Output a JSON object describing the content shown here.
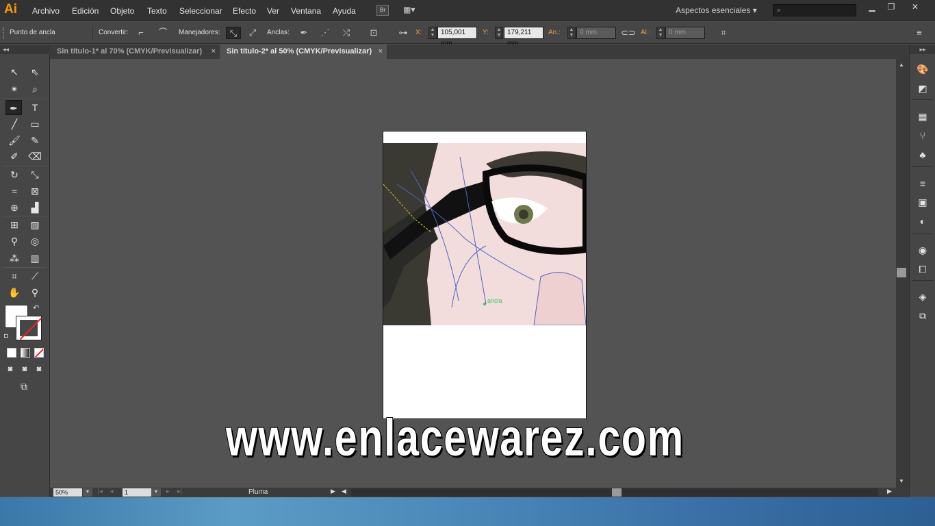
{
  "app": {
    "logo": "Ai",
    "menus": [
      "Archivo",
      "Edición",
      "Objeto",
      "Texto",
      "Seleccionar",
      "Efecto",
      "Ver",
      "Ventana",
      "Ayuda"
    ],
    "bridge_label": "Br",
    "workspace": "Aspectos esenciales",
    "search_placeholder": "⌕"
  },
  "control_bar": {
    "selection_label": "Punto de ancla",
    "convert_label": "Convertir:",
    "handles_label": "Manejadores:",
    "anchors_label": "Anclas:",
    "x_label": "X:",
    "x_value": "105,001 mm",
    "y_label": "Y:",
    "y_value": "179,211 mm",
    "w_label": "An.:",
    "w_value": "0 mm",
    "h_label": "Al.:",
    "h_value": "0 mm"
  },
  "tabs": [
    {
      "label": "Sin título-1* al 70% (CMYK/Previsualizar)",
      "close": "×"
    },
    {
      "label": "Sin título-2* al 50% (CMYK/Previsualizar)",
      "close": "×"
    }
  ],
  "canvas": {
    "anchor_label": "ancla",
    "watermark": "www.enlacewarez.com"
  },
  "status": {
    "zoom": "50%",
    "page": "1",
    "tool_name": "Pluma"
  }
}
